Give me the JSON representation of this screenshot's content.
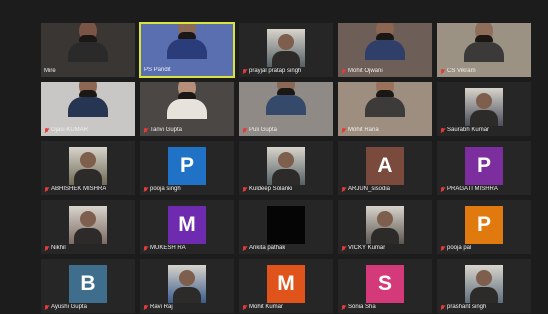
{
  "colors": {
    "background": "#1c1c1c",
    "tile": "#262626",
    "speaker_border": "#d9e33a",
    "mic_muted": "#e23b3b"
  },
  "participants": [
    {
      "name": "Mire",
      "kind": "video",
      "muted": false
    },
    {
      "name": "PS Pandit",
      "kind": "video",
      "muted": false,
      "speaking": true
    },
    {
      "name": "prayjal pratap singh",
      "kind": "photo",
      "muted": true
    },
    {
      "name": "Mohit Ojwani",
      "kind": "video",
      "muted": true
    },
    {
      "name": "CS Vikram",
      "kind": "video",
      "muted": true
    },
    {
      "name": "Ojasi KUMAR",
      "kind": "video",
      "muted": true
    },
    {
      "name": "Tanvi Gupta",
      "kind": "video",
      "muted": true
    },
    {
      "name": "Puli Gupta",
      "kind": "video",
      "muted": true
    },
    {
      "name": "Mohit Rana",
      "kind": "video",
      "muted": true
    },
    {
      "name": "Saurabh Kumar",
      "kind": "photo",
      "muted": true
    },
    {
      "name": "ABHISHEK MISHRA",
      "kind": "photo",
      "muted": true
    },
    {
      "name": "pooja singh",
      "kind": "avatar",
      "letter": "P",
      "color": "#1f72c6",
      "muted": true
    },
    {
      "name": "Kuldeep Solanki",
      "kind": "photo",
      "muted": true
    },
    {
      "name": "ARJUN_sisodia",
      "kind": "avatar",
      "letter": "A",
      "color": "#7a4a3c",
      "muted": true
    },
    {
      "name": "PRAGATI MISHRA",
      "kind": "avatar",
      "letter": "P",
      "color": "#7c2e9e",
      "muted": true
    },
    {
      "name": "Nikhil",
      "kind": "photo",
      "muted": true
    },
    {
      "name": "MUKESH RA",
      "kind": "avatar",
      "letter": "M",
      "color": "#6e2bb0",
      "muted": true
    },
    {
      "name": "Ankita pathak",
      "kind": "black",
      "muted": true
    },
    {
      "name": "VICKY Kumar",
      "kind": "photo",
      "muted": true
    },
    {
      "name": "pooja pal",
      "kind": "avatar",
      "letter": "P",
      "color": "#e07a0e",
      "muted": true
    },
    {
      "name": "Ayushi Gupta",
      "kind": "avatar",
      "letter": "B",
      "color": "#3f6d8c",
      "muted": true
    },
    {
      "name": "Ravi Raj",
      "kind": "photo",
      "muted": true
    },
    {
      "name": "Mohit Kumar",
      "kind": "avatar",
      "letter": "M",
      "color": "#e0531a",
      "muted": true
    },
    {
      "name": "Sonia Sha",
      "kind": "avatar",
      "letter": "S",
      "color": "#d43a7a",
      "muted": true
    },
    {
      "name": "prashant singh",
      "kind": "photo",
      "muted": true
    }
  ]
}
